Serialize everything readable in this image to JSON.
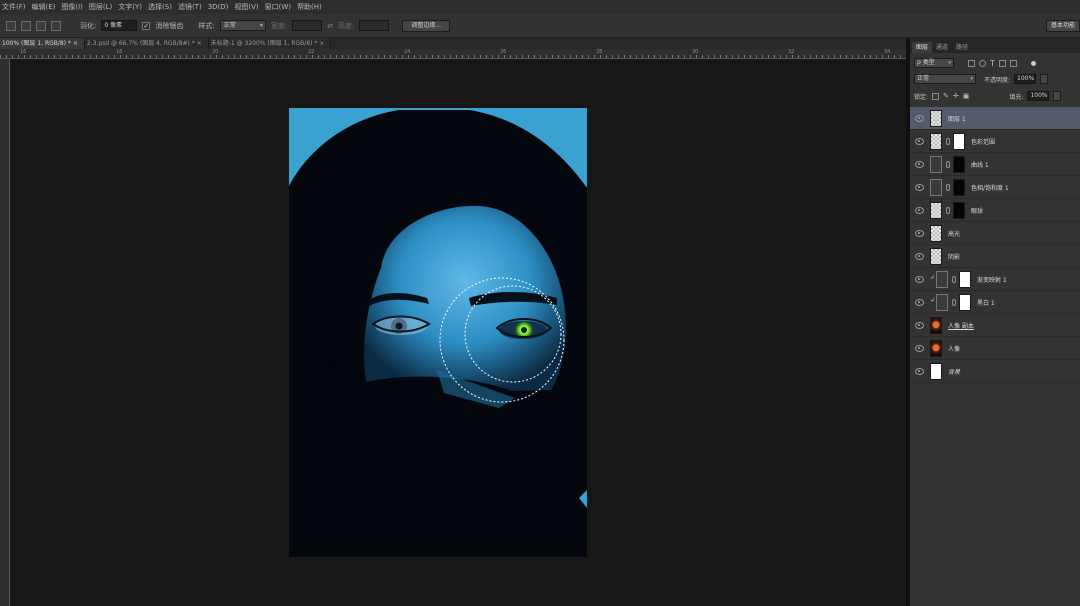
{
  "menu": [
    "文件(F)",
    "编辑(E)",
    "图像(I)",
    "图层(L)",
    "文字(Y)",
    "选择(S)",
    "滤镜(T)",
    "3D(D)",
    "视图(V)",
    "窗口(W)",
    "帮助(H)"
  ],
  "options": {
    "feather_label": "羽化:",
    "feather_value": "0 像素",
    "antialias_label": "消除锯齿",
    "antialias_checked": true,
    "style_label": "样式:",
    "style_value": "正常",
    "width_label": "宽度:",
    "height_label": "高度:",
    "refine_button": "调整边缘...",
    "workspace": "基本功能"
  },
  "doc_tabs": [
    {
      "label": "100% (图层 1, RGB/8) *",
      "active": true
    },
    {
      "label": "2.3.psd @ 66.7% (图层 4, RGB/8#) *",
      "active": false
    },
    {
      "label": "未标题-1 @ 3200% (图层 1, RGB/8) *",
      "active": false
    }
  ],
  "ruler_numbers": [
    "16",
    "18",
    "20",
    "22",
    "24",
    "26",
    "28",
    "30",
    "32",
    "34"
  ],
  "panel": {
    "tabs": [
      "图层",
      "通道",
      "路径"
    ],
    "filter_kind": "ρ 类型",
    "blend_mode": "正常",
    "opacity_label": "不透明度:",
    "opacity_value": "100%",
    "lock_label": "锁定:",
    "fill_label": "填充:",
    "fill_value": "100%"
  },
  "layers": [
    {
      "name": "图层 1",
      "thumb": "trans",
      "mask": false,
      "selected": true
    },
    {
      "name": "色彩范围",
      "thumb": "trans",
      "mask": "white",
      "selected": false
    },
    {
      "name": "曲线 1",
      "thumb": "adj",
      "mask": "black",
      "selected": false
    },
    {
      "name": "色相/饱和度 1",
      "thumb": "adj",
      "mask": "black",
      "selected": false
    },
    {
      "name": "眼球",
      "thumb": "trans",
      "mask": "black",
      "selected": false
    },
    {
      "name": "高光",
      "thumb": "trans",
      "mask": false,
      "selected": false
    },
    {
      "name": "阴影",
      "thumb": "trans",
      "mask": false,
      "selected": false
    },
    {
      "name": "渐变映射 1",
      "thumb": "adj",
      "mask": "white",
      "selected": false,
      "clipped": true
    },
    {
      "name": "黑白 1",
      "thumb": "adj",
      "mask": "white",
      "selected": false,
      "clipped": true
    },
    {
      "name": "人像 副本",
      "thumb": "photo",
      "mask": false,
      "selected": false,
      "underline": true
    },
    {
      "name": "人像",
      "thumb": "photo",
      "mask": false,
      "selected": false
    },
    {
      "name": "背景",
      "thumb": "white",
      "mask": false,
      "selected": false,
      "italic": true
    }
  ],
  "colors": {
    "photo_blue": "#3aa2d0",
    "eye_green": "#7cff3a",
    "selected_layer": "#545a6c"
  }
}
